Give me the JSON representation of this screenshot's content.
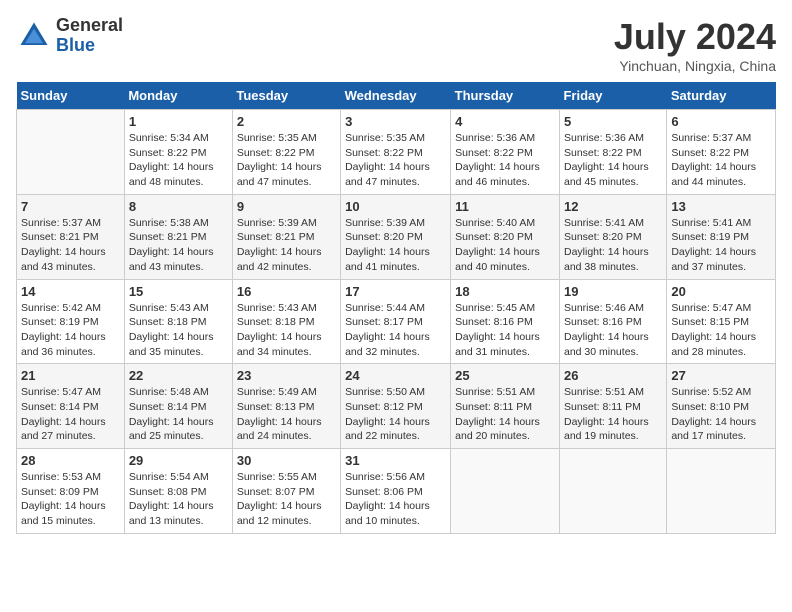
{
  "logo": {
    "general": "General",
    "blue": "Blue"
  },
  "title": "July 2024",
  "subtitle": "Yinchuan, Ningxia, China",
  "days_of_week": [
    "Sunday",
    "Monday",
    "Tuesday",
    "Wednesday",
    "Thursday",
    "Friday",
    "Saturday"
  ],
  "weeks": [
    [
      {
        "day": "",
        "info": ""
      },
      {
        "day": "1",
        "info": "Sunrise: 5:34 AM\nSunset: 8:22 PM\nDaylight: 14 hours\nand 48 minutes."
      },
      {
        "day": "2",
        "info": "Sunrise: 5:35 AM\nSunset: 8:22 PM\nDaylight: 14 hours\nand 47 minutes."
      },
      {
        "day": "3",
        "info": "Sunrise: 5:35 AM\nSunset: 8:22 PM\nDaylight: 14 hours\nand 47 minutes."
      },
      {
        "day": "4",
        "info": "Sunrise: 5:36 AM\nSunset: 8:22 PM\nDaylight: 14 hours\nand 46 minutes."
      },
      {
        "day": "5",
        "info": "Sunrise: 5:36 AM\nSunset: 8:22 PM\nDaylight: 14 hours\nand 45 minutes."
      },
      {
        "day": "6",
        "info": "Sunrise: 5:37 AM\nSunset: 8:22 PM\nDaylight: 14 hours\nand 44 minutes."
      }
    ],
    [
      {
        "day": "7",
        "info": "Sunrise: 5:37 AM\nSunset: 8:21 PM\nDaylight: 14 hours\nand 43 minutes."
      },
      {
        "day": "8",
        "info": "Sunrise: 5:38 AM\nSunset: 8:21 PM\nDaylight: 14 hours\nand 43 minutes."
      },
      {
        "day": "9",
        "info": "Sunrise: 5:39 AM\nSunset: 8:21 PM\nDaylight: 14 hours\nand 42 minutes."
      },
      {
        "day": "10",
        "info": "Sunrise: 5:39 AM\nSunset: 8:20 PM\nDaylight: 14 hours\nand 41 minutes."
      },
      {
        "day": "11",
        "info": "Sunrise: 5:40 AM\nSunset: 8:20 PM\nDaylight: 14 hours\nand 40 minutes."
      },
      {
        "day": "12",
        "info": "Sunrise: 5:41 AM\nSunset: 8:20 PM\nDaylight: 14 hours\nand 38 minutes."
      },
      {
        "day": "13",
        "info": "Sunrise: 5:41 AM\nSunset: 8:19 PM\nDaylight: 14 hours\nand 37 minutes."
      }
    ],
    [
      {
        "day": "14",
        "info": "Sunrise: 5:42 AM\nSunset: 8:19 PM\nDaylight: 14 hours\nand 36 minutes."
      },
      {
        "day": "15",
        "info": "Sunrise: 5:43 AM\nSunset: 8:18 PM\nDaylight: 14 hours\nand 35 minutes."
      },
      {
        "day": "16",
        "info": "Sunrise: 5:43 AM\nSunset: 8:18 PM\nDaylight: 14 hours\nand 34 minutes."
      },
      {
        "day": "17",
        "info": "Sunrise: 5:44 AM\nSunset: 8:17 PM\nDaylight: 14 hours\nand 32 minutes."
      },
      {
        "day": "18",
        "info": "Sunrise: 5:45 AM\nSunset: 8:16 PM\nDaylight: 14 hours\nand 31 minutes."
      },
      {
        "day": "19",
        "info": "Sunrise: 5:46 AM\nSunset: 8:16 PM\nDaylight: 14 hours\nand 30 minutes."
      },
      {
        "day": "20",
        "info": "Sunrise: 5:47 AM\nSunset: 8:15 PM\nDaylight: 14 hours\nand 28 minutes."
      }
    ],
    [
      {
        "day": "21",
        "info": "Sunrise: 5:47 AM\nSunset: 8:14 PM\nDaylight: 14 hours\nand 27 minutes."
      },
      {
        "day": "22",
        "info": "Sunrise: 5:48 AM\nSunset: 8:14 PM\nDaylight: 14 hours\nand 25 minutes."
      },
      {
        "day": "23",
        "info": "Sunrise: 5:49 AM\nSunset: 8:13 PM\nDaylight: 14 hours\nand 24 minutes."
      },
      {
        "day": "24",
        "info": "Sunrise: 5:50 AM\nSunset: 8:12 PM\nDaylight: 14 hours\nand 22 minutes."
      },
      {
        "day": "25",
        "info": "Sunrise: 5:51 AM\nSunset: 8:11 PM\nDaylight: 14 hours\nand 20 minutes."
      },
      {
        "day": "26",
        "info": "Sunrise: 5:51 AM\nSunset: 8:11 PM\nDaylight: 14 hours\nand 19 minutes."
      },
      {
        "day": "27",
        "info": "Sunrise: 5:52 AM\nSunset: 8:10 PM\nDaylight: 14 hours\nand 17 minutes."
      }
    ],
    [
      {
        "day": "28",
        "info": "Sunrise: 5:53 AM\nSunset: 8:09 PM\nDaylight: 14 hours\nand 15 minutes."
      },
      {
        "day": "29",
        "info": "Sunrise: 5:54 AM\nSunset: 8:08 PM\nDaylight: 14 hours\nand 13 minutes."
      },
      {
        "day": "30",
        "info": "Sunrise: 5:55 AM\nSunset: 8:07 PM\nDaylight: 14 hours\nand 12 minutes."
      },
      {
        "day": "31",
        "info": "Sunrise: 5:56 AM\nSunset: 8:06 PM\nDaylight: 14 hours\nand 10 minutes."
      },
      {
        "day": "",
        "info": ""
      },
      {
        "day": "",
        "info": ""
      },
      {
        "day": "",
        "info": ""
      }
    ]
  ]
}
